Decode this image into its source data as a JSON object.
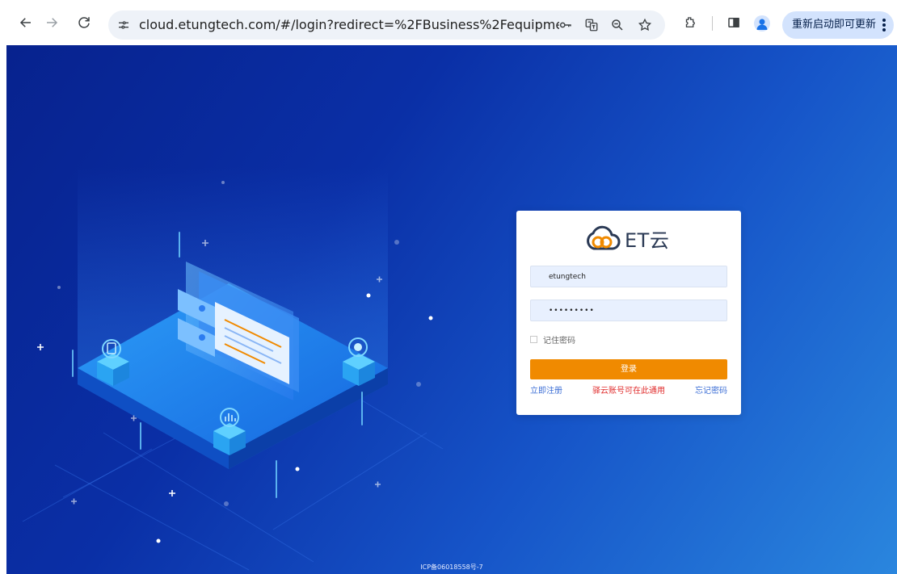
{
  "browser": {
    "url": "cloud.etungtech.com/#/login?redirect=%2FBusiness%2Fequipment%2...",
    "update_label": "重新启动即可更新"
  },
  "login": {
    "brand": "ET云",
    "username_value": "etungtech",
    "password_value": "•••••••••",
    "remember_label": "记住密码",
    "submit_label": "登录",
    "register_link": "立即注册",
    "note_text": "驿云账号可在此通用",
    "forgot_link": "忘记密码"
  },
  "footer": {
    "icp": "ICP备06018558号-7"
  },
  "colors": {
    "bg_start": "#07228e",
    "bg_end": "#2a86de",
    "accent_button": "#f08a00",
    "link": "#3d6fd6",
    "note": "#e02d2d"
  }
}
